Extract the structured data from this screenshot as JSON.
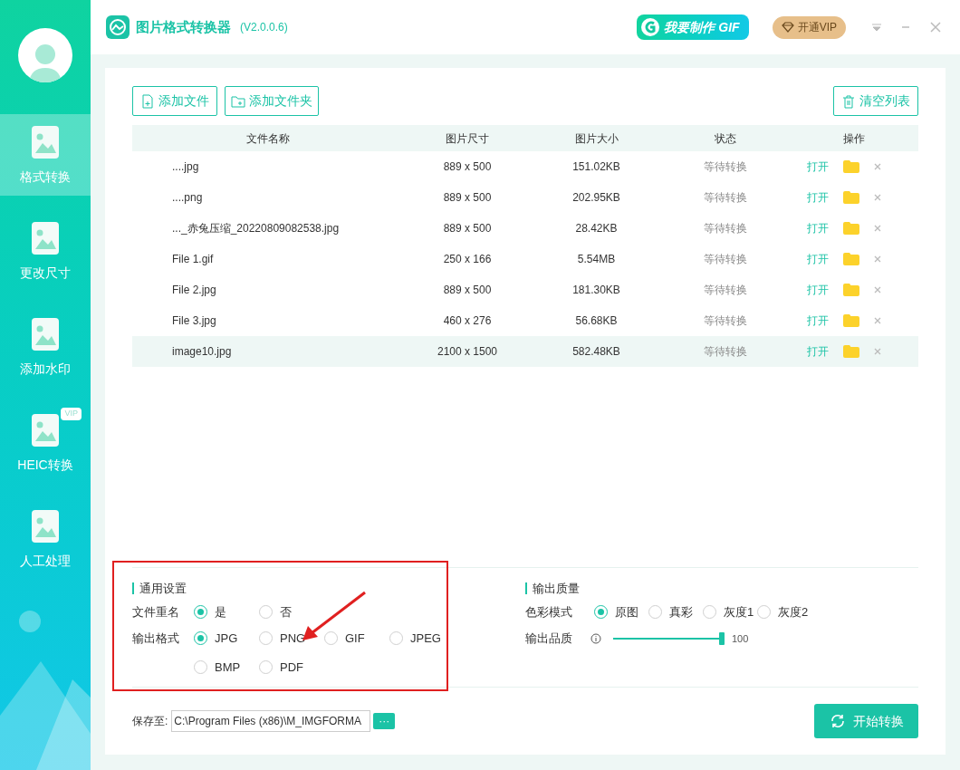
{
  "sidebar": {
    "items": [
      {
        "label": "格式转换",
        "selected": true
      },
      {
        "label": "更改尺寸",
        "selected": false
      },
      {
        "label": "添加水印",
        "selected": false
      },
      {
        "label": "HEIC转换",
        "selected": false,
        "badge": "VIP"
      },
      {
        "label": "人工处理",
        "selected": false
      }
    ]
  },
  "titlebar": {
    "title": "图片格式转换器",
    "version": "(V2.0.0.6)",
    "gif_button": "我要制作 GIF",
    "vip_button": "开通VIP"
  },
  "toolbar": {
    "add_file": "添加文件",
    "add_folder": "添加文件夹",
    "clear": "清空列表"
  },
  "table": {
    "columns": [
      "文件名称",
      "图片尺寸",
      "图片大小",
      "状态",
      "操作"
    ],
    "rows": [
      {
        "name": "....jpg",
        "dims": "889 x 500",
        "size": "151.02KB",
        "status": "等待转换",
        "open": "打开",
        "selected": false
      },
      {
        "name": "....png",
        "dims": "889 x 500",
        "size": "202.95KB",
        "status": "等待转换",
        "open": "打开",
        "selected": false
      },
      {
        "name": "..._赤兔压缩_20220809082538.jpg",
        "dims": "889 x 500",
        "size": "28.42KB",
        "status": "等待转换",
        "open": "打开",
        "selected": false
      },
      {
        "name": "File 1.gif",
        "dims": "250 x 166",
        "size": "5.54MB",
        "status": "等待转换",
        "open": "打开",
        "selected": false
      },
      {
        "name": "File 2.jpg",
        "dims": "889 x 500",
        "size": "181.30KB",
        "status": "等待转换",
        "open": "打开",
        "selected": false
      },
      {
        "name": "File 3.jpg",
        "dims": "460 x 276",
        "size": "56.68KB",
        "status": "等待转换",
        "open": "打开",
        "selected": false
      },
      {
        "name": "image10.jpg",
        "dims": "2100 x 1500",
        "size": "582.48KB",
        "status": "等待转换",
        "open": "打开",
        "selected": true
      }
    ]
  },
  "general": {
    "title": "通用设置",
    "rename": {
      "label": "文件重名",
      "options": [
        {
          "label": "是",
          "selected": true
        },
        {
          "label": "否",
          "selected": false
        }
      ]
    },
    "format": {
      "label": "输出格式",
      "options": [
        {
          "label": "JPG",
          "selected": true
        },
        {
          "label": "PNG",
          "selected": false
        },
        {
          "label": "GIF",
          "selected": false
        },
        {
          "label": "JPEG",
          "selected": false
        },
        {
          "label": "BMP",
          "selected": false
        },
        {
          "label": "PDF",
          "selected": false
        }
      ]
    }
  },
  "quality": {
    "title": "输出质量",
    "color_mode": {
      "label": "色彩模式",
      "options": [
        {
          "label": "原图",
          "selected": true
        },
        {
          "label": "真彩",
          "selected": false
        },
        {
          "label": "灰度1",
          "selected": false
        },
        {
          "label": "灰度2",
          "selected": false
        }
      ]
    },
    "output": {
      "label": "输出品质",
      "level": 1.0,
      "reading": "100"
    }
  },
  "save": {
    "label": "保存至:",
    "path": "C:\\Program Files (x86)\\M_IMGFORMA",
    "browse": "···"
  },
  "start_button": "开始转换"
}
